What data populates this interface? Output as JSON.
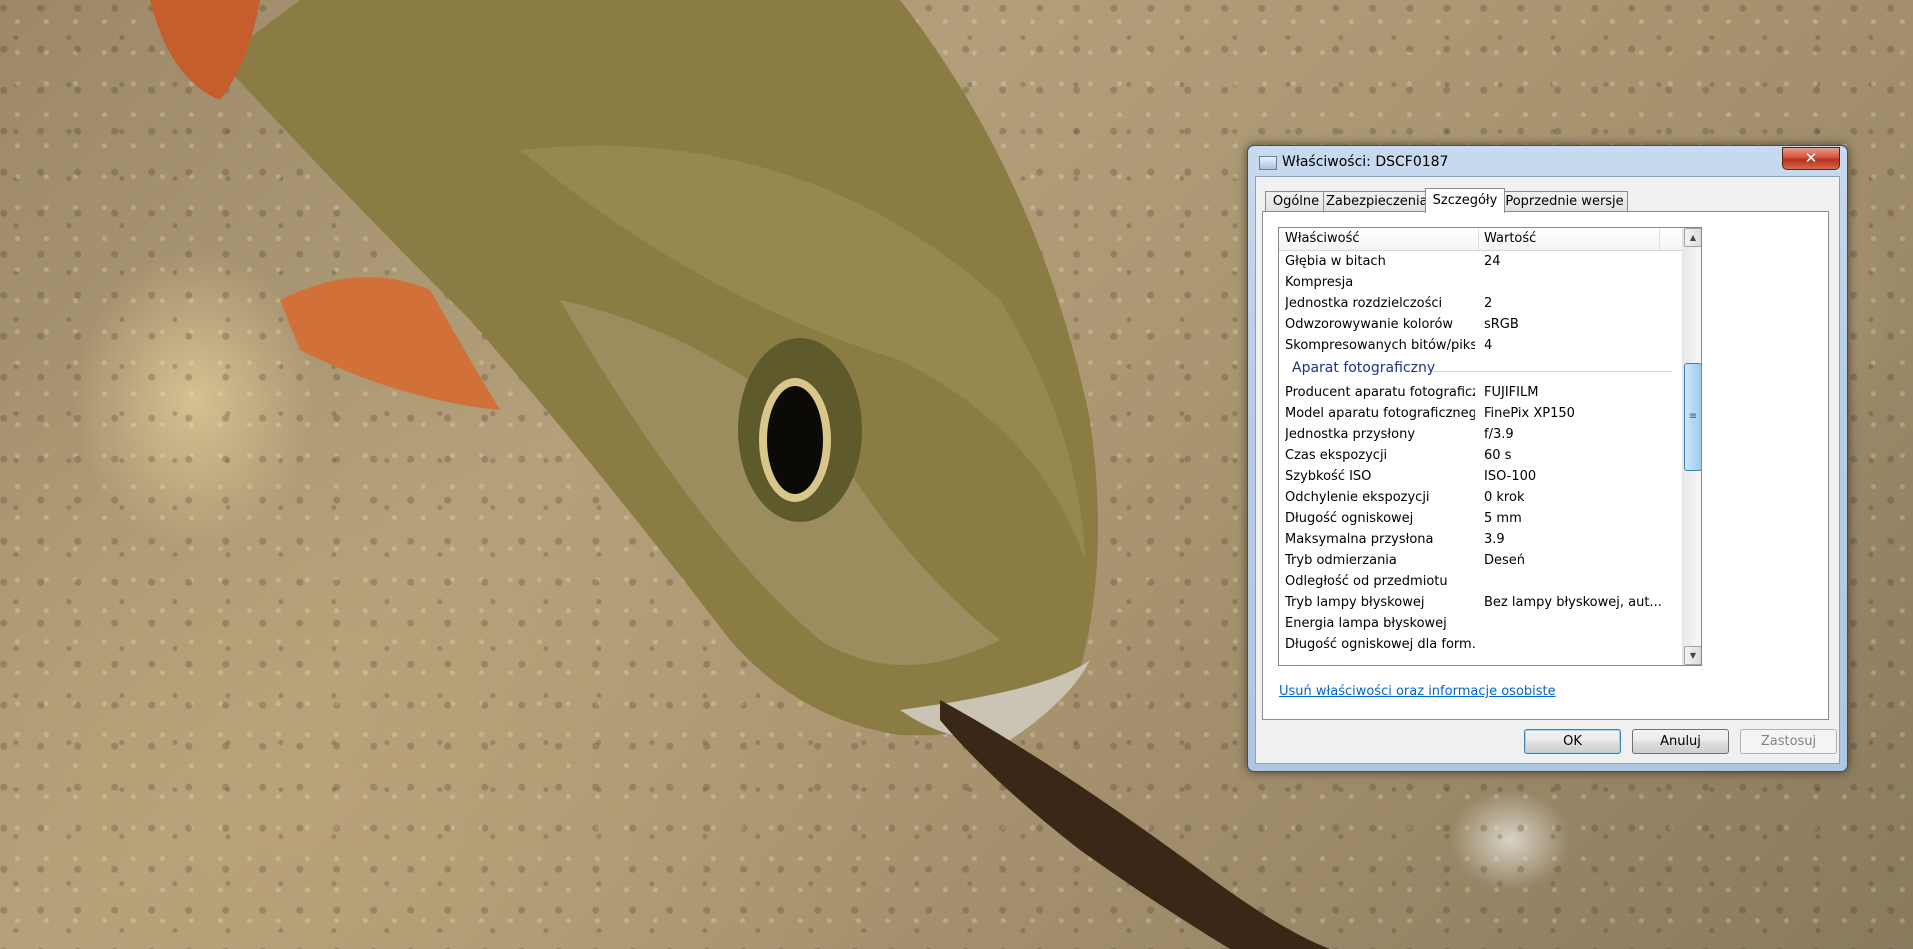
{
  "window": {
    "title": "Właściwości: DSCF0187",
    "close_label": "✕"
  },
  "tabs": [
    {
      "label": "Ogólne"
    },
    {
      "label": "Zabezpieczenia"
    },
    {
      "label": "Szczegóły",
      "active": true
    },
    {
      "label": "Poprzednie wersje"
    }
  ],
  "list": {
    "headers": {
      "property": "Właściwość",
      "value": "Wartość"
    },
    "rows_image": [
      {
        "p": "Głębia w bitach",
        "v": "24"
      },
      {
        "p": "Kompresja",
        "v": ""
      },
      {
        "p": "Jednostka rozdzielczości",
        "v": "2"
      },
      {
        "p": "Odwzorowywanie kolorów",
        "v": "sRGB"
      },
      {
        "p": "Skompresowanych bitów/piksel",
        "v": "4"
      }
    ],
    "group_camera": "Aparat fotograficzny",
    "rows_camera": [
      {
        "p": "Producent aparatu fotograficzn...",
        "v": "FUJIFILM"
      },
      {
        "p": "Model aparatu fotograficznego",
        "v": "FinePix XP150"
      },
      {
        "p": "Jednostka przysłony",
        "v": "f/3.9"
      },
      {
        "p": "Czas ekspozycji",
        "v": "60 s"
      },
      {
        "p": "Szybkość ISO",
        "v": "ISO-100"
      },
      {
        "p": "Odchylenie ekspozycji",
        "v": "0 krok"
      },
      {
        "p": "Długość ogniskowej",
        "v": "5 mm"
      },
      {
        "p": "Maksymalna przysłona",
        "v": "3.9"
      },
      {
        "p": "Tryb odmierzania",
        "v": "Deseń"
      },
      {
        "p": "Odległość od przedmiotu",
        "v": ""
      },
      {
        "p": "Tryb lampy błyskowej",
        "v": "Bez lampy błyskowej, aut..."
      },
      {
        "p": "Energia lampa błyskowej",
        "v": ""
      },
      {
        "p": "Długość ogniskowej dla form...",
        "v": ""
      }
    ]
  },
  "scrollbar": {
    "up": "▲",
    "down": "▼",
    "grip": "≡"
  },
  "link_remove": "Usuń właściwości oraz informacje osobiste",
  "buttons": {
    "ok": "OK",
    "cancel": "Anuluj",
    "apply": "Zastosuj"
  },
  "icons": {
    "window_icon": "image-file-icon"
  }
}
